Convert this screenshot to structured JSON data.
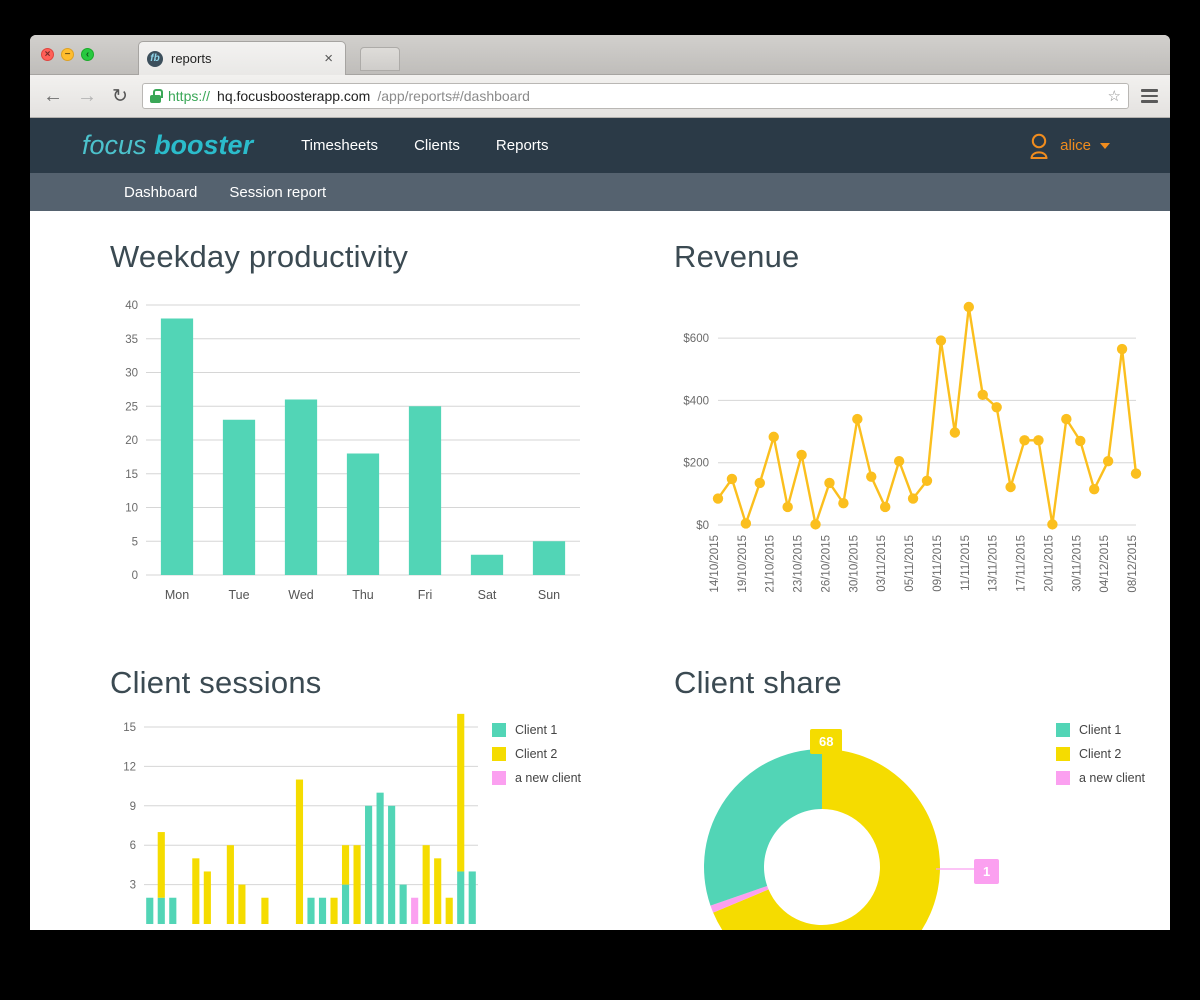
{
  "browser": {
    "tab_title": "reports",
    "favicon_text": "fb",
    "tab_close": "×",
    "back_icon": "←",
    "forward_icon": "→",
    "reload_icon": "↻",
    "url_scheme": "https://",
    "url_host": "hq.focusboosterapp.com",
    "url_path": "/app/reports#/dashboard",
    "star_icon": "☆",
    "menu_icon": "hamburger-icon",
    "traffic_close": "×",
    "traffic_min": "−",
    "traffic_max": "‹"
  },
  "appnav": {
    "logo_light": "focus",
    "logo_bold": "booster",
    "items": [
      {
        "label": "Timesheets"
      },
      {
        "label": "Clients"
      },
      {
        "label": "Reports"
      }
    ],
    "user": {
      "name": "alice",
      "icon": "user-icon"
    }
  },
  "subnav": {
    "items": [
      {
        "label": "Dashboard"
      },
      {
        "label": "Session report"
      }
    ]
  },
  "colors": {
    "teal": "#52D5B6",
    "yellow": "#F5DC00",
    "pink": "#FBA0F0",
    "gold": "#FBBF1E",
    "navy": "#2B3A47",
    "slate": "#55626F",
    "orange": "#F08C1E",
    "logo_cyan": "#3FB8C4"
  },
  "chart_data": [
    {
      "id": "weekday-productivity",
      "type": "bar",
      "title": "Weekday productivity",
      "xlabel": "",
      "ylabel": "",
      "ylim": [
        0,
        40
      ],
      "yticks": [
        0,
        5,
        10,
        15,
        20,
        25,
        30,
        35,
        40
      ],
      "ytick_labels": [
        "0",
        "5",
        "10",
        "15",
        "20",
        "25",
        "30",
        "35",
        "40"
      ],
      "grid": true,
      "legend": "none",
      "color": "#52D5B6",
      "categories": [
        "Mon",
        "Tue",
        "Wed",
        "Thu",
        "Fri",
        "Sat",
        "Sun"
      ],
      "values": [
        38,
        23,
        26,
        18,
        25,
        3,
        5
      ]
    },
    {
      "id": "revenue",
      "type": "line",
      "title": "Revenue",
      "xlabel": "",
      "ylabel": "",
      "ylim": [
        0,
        700
      ],
      "yticks": [
        0,
        200,
        400,
        600
      ],
      "ytick_labels": [
        "$0",
        "$200",
        "$400",
        "$600"
      ],
      "grid": true,
      "legend": "none",
      "color": "#FBBF1E",
      "markers": true,
      "xtick_labels": [
        "14/10/2015",
        "19/10/2015",
        "21/10/2015",
        "23/10/2015",
        "26/10/2015",
        "30/10/2015",
        "03/11/2015",
        "05/11/2015",
        "09/11/2015",
        "11/11/2015",
        "13/11/2015",
        "17/11/2015",
        "20/11/2015",
        "30/11/2015",
        "04/12/2015",
        "08/12/2015"
      ],
      "xtick_indices": [
        0,
        2,
        4,
        6,
        8,
        10,
        12,
        14,
        16,
        18,
        20,
        22,
        24,
        26,
        28,
        30
      ],
      "values": [
        85,
        148,
        5,
        135,
        283,
        58,
        225,
        2,
        135,
        70,
        340,
        155,
        58,
        205,
        85,
        142,
        592,
        297,
        700,
        418,
        378,
        122,
        272,
        272,
        2,
        340,
        270,
        115,
        205,
        565,
        165
      ]
    },
    {
      "id": "client-sessions",
      "type": "bar",
      "title": "Client sessions",
      "stacked": true,
      "xlabel": "",
      "ylabel": "",
      "ylim": [
        0,
        15
      ],
      "yticks": [
        3,
        6,
        9,
        12,
        15
      ],
      "ytick_labels": [
        "3",
        "6",
        "9",
        "12",
        "15"
      ],
      "grid": true,
      "legend": "right",
      "series": [
        {
          "name": "Client 1",
          "color": "#52D5B6",
          "values": [
            2,
            2,
            2,
            0,
            0,
            0,
            0,
            0,
            0,
            0,
            0,
            0,
            0,
            0,
            2,
            2,
            0,
            3,
            0,
            9,
            10,
            9,
            3,
            0,
            0,
            0,
            0,
            4,
            4
          ]
        },
        {
          "name": "Client 2",
          "color": "#F5DC00",
          "values": [
            0,
            5,
            0,
            0,
            5,
            4,
            0,
            6,
            3,
            0,
            2,
            0,
            0,
            11,
            0,
            0,
            2,
            3,
            6,
            0,
            0,
            0,
            0,
            0,
            6,
            5,
            2,
            12,
            0
          ]
        },
        {
          "name": "a new client",
          "color": "#FBA0F0",
          "values": [
            0,
            0,
            0,
            0,
            0,
            0,
            0,
            0,
            0,
            0,
            0,
            0,
            0,
            0,
            0,
            0,
            0,
            0,
            0,
            0,
            0,
            0,
            0,
            2,
            0,
            0,
            0,
            0,
            0
          ]
        }
      ]
    },
    {
      "id": "client-share",
      "type": "pie",
      "title": "Client share",
      "donut": true,
      "legend": "right",
      "labels": [
        "Client 1",
        "Client 2",
        "a new client"
      ],
      "colors": [
        "#52D5B6",
        "#F5DC00",
        "#FBA0F0"
      ],
      "values": [
        30,
        68,
        1
      ],
      "data_labels": [
        {
          "text": "68",
          "series": "Client 2",
          "color": "#F5DC00"
        },
        {
          "text": "1",
          "series": "a new client",
          "color": "#FBA0F0"
        }
      ]
    }
  ]
}
